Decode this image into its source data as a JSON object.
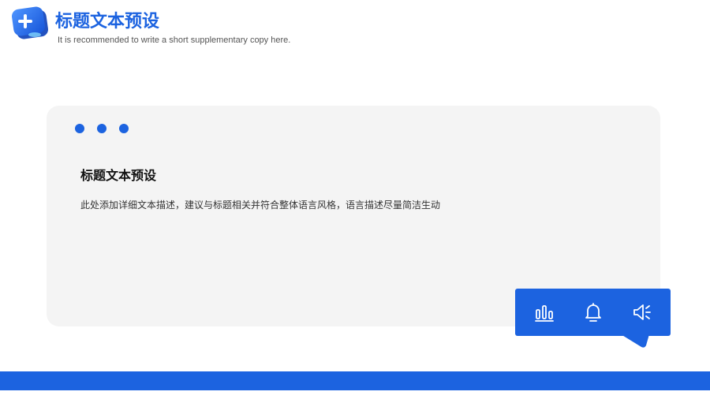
{
  "header": {
    "title": "标题文本预设",
    "subtitle": "It is recommended to write a short supplementary copy here.",
    "logo_icon": "plus-cube-icon"
  },
  "card": {
    "title": "标题文本预设",
    "description": "此处添加详细文本描述，建议与标题相关并符合整体语言风格，语言描述尽量简洁生动",
    "dots": 3
  },
  "toolbar": {
    "icons": [
      "bar-chart-icon",
      "bell-icon",
      "speaker-icon"
    ]
  },
  "colors": {
    "accent": "#1c63e0",
    "card_bg": "#f4f4f4",
    "text_dark": "#111111",
    "text_body": "#333333"
  }
}
